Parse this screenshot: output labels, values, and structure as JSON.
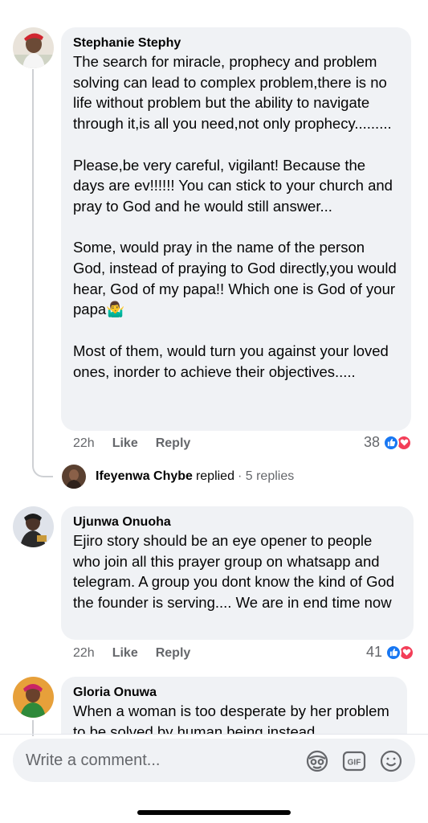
{
  "comments": [
    {
      "author": "Stephanie Stephy",
      "text": "The search for miracle, prophecy and problem solving can lead to complex problem,there is no life without problem but the ability to navigate through it,is all you need,not only prophecy.........\n\nPlease,be very careful, vigilant! Because the days are ev!!!!!! You can stick to your church and pray to God and he would still answer...\n\nSome, would pray in the name of the person God, instead of praying to God directly,you would hear, God of my papa!! Which one is God of your papa🤷‍♂️\n\nMost of them, would turn you against your loved ones, inorder to achieve their objectives.....",
      "time": "22h",
      "like_label": "Like",
      "reply_label": "Reply",
      "reaction_count": "38",
      "reactions": [
        "like-icon",
        "love-icon"
      ],
      "replies": {
        "name": "Ifeyenwa Chybe",
        "verb": "replied",
        "count": "· 5 replies"
      }
    },
    {
      "author": "Ujunwa Onuoha",
      "text": "Ejiro story should be an eye opener to people who join all this prayer group on whatsapp and telegram. A group you dont know the kind of God the founder is serving.... We are in end time now",
      "time": "22h",
      "like_label": "Like",
      "reply_label": "Reply",
      "reaction_count": "41",
      "reactions": [
        "like-icon",
        "love-icon"
      ]
    },
    {
      "author": "Gloria Onuwa",
      "text": "When a woman is too desperate by her problem to be solved by human being instead"
    }
  ],
  "composer": {
    "placeholder": "Write a comment...",
    "icons": [
      "avatar-sticker-icon",
      "gif-icon",
      "emoji-icon"
    ]
  },
  "colors": {
    "bubble": "#f0f2f5",
    "like_blue": "#1877f2",
    "love_red": "#f33e58",
    "meta_gray": "#65676b"
  }
}
